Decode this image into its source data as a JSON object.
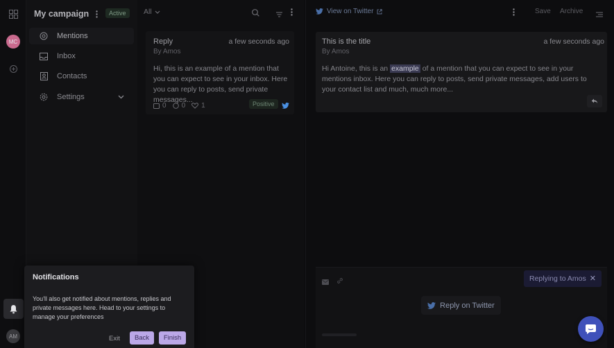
{
  "rail": {
    "avatar_top": "MC",
    "avatar_bottom": "AM",
    "avatar_top_color": "#c96a8e",
    "avatar_bottom_color": "#3a3a3e"
  },
  "sidebar": {
    "campaign_title": "My campaign",
    "status_badge": "Active",
    "items": [
      {
        "label": "Mentions",
        "icon": "at-icon",
        "selected": true
      },
      {
        "label": "Inbox",
        "icon": "inbox-icon",
        "selected": false
      },
      {
        "label": "Contacts",
        "icon": "contacts-icon",
        "selected": false
      },
      {
        "label": "Settings",
        "icon": "gear-icon",
        "selected": false
      }
    ]
  },
  "list": {
    "filter_label": "All",
    "mention": {
      "title": "Reply",
      "time": "a few seconds ago",
      "author": "By Amos",
      "body": "Hi, this is an example of a mention that you can expect to see in your inbox. Here you can reply to posts, send private messages...",
      "comments": "0",
      "replies": "0",
      "likes": "1",
      "sentiment": "Positive"
    }
  },
  "detail": {
    "view_link": "View on Twitter",
    "save_label": "Save",
    "archive_label": "Archive",
    "title": "This is the title",
    "time": "a few seconds ago",
    "author": "By Amos",
    "body_before": "Hi Antoine, this is an",
    "body_highlight": "example",
    "body_after": "of a mention that you can expect to see in your mentions inbox. Here you can reply to posts, send private messages, add users to your contact list and much, much more...",
    "replying_to": "Replying to Amos",
    "reply_button": "Reply on Twitter"
  },
  "notification": {
    "title": "Notifications",
    "body": "You'll also get notified about mentions, replies and private messages here. Head to your settings to manage your preferences",
    "exit_label": "Exit",
    "back_label": "Back",
    "finish_label": "Finish"
  },
  "colors": {
    "accent": "#bba8e8",
    "twitter": "#4a90e2",
    "fab": "#3f51ba"
  }
}
